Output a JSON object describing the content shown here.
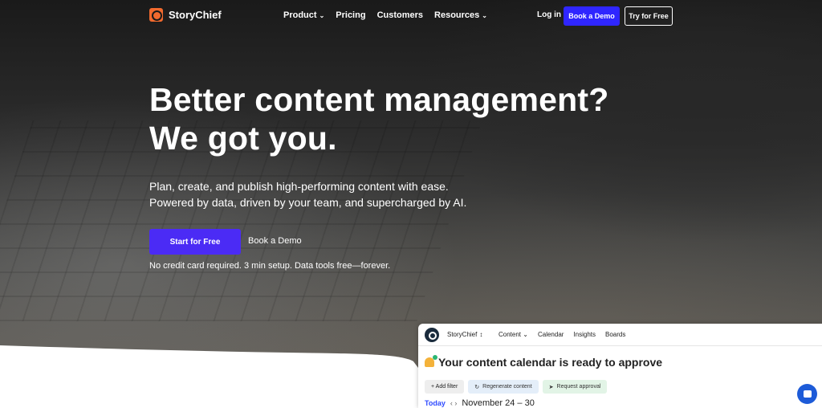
{
  "brand": {
    "name": "StoryChief",
    "accent": "#f26a2e"
  },
  "nav": {
    "links": [
      {
        "label": "Product",
        "dropdown": true
      },
      {
        "label": "Pricing",
        "dropdown": false
      },
      {
        "label": "Customers",
        "dropdown": false
      },
      {
        "label": "Resources",
        "dropdown": true
      }
    ],
    "login": "Log in",
    "book_demo": "Book a Demo",
    "try_free": "Try for Free"
  },
  "hero": {
    "headline_line1": "Better content management?",
    "headline_line2": "We got you.",
    "sub_line1": "Plan, create, and publish high-performing content with ease.",
    "sub_line2": "Powered by data, driven by your team, and supercharged by AI.",
    "cta_primary": "Start for Free",
    "cta_secondary": "Book a Demo",
    "note": "No credit card required. 3 min setup. Data tools free—forever."
  },
  "app_preview": {
    "workspace": "StoryChief",
    "nav": [
      "Content",
      "Calendar",
      "Insights",
      "Boards"
    ],
    "title": "Your content calendar is ready to approve",
    "chips": {
      "filter": "+ Add filter",
      "regen": "Regenerate content",
      "approve": "Request approval"
    },
    "today": "Today",
    "range": "November 24 – 30"
  },
  "colors": {
    "primary_button": "#2f26ff",
    "cta": "#4b2bf5",
    "chat": "#1d5bd8"
  }
}
